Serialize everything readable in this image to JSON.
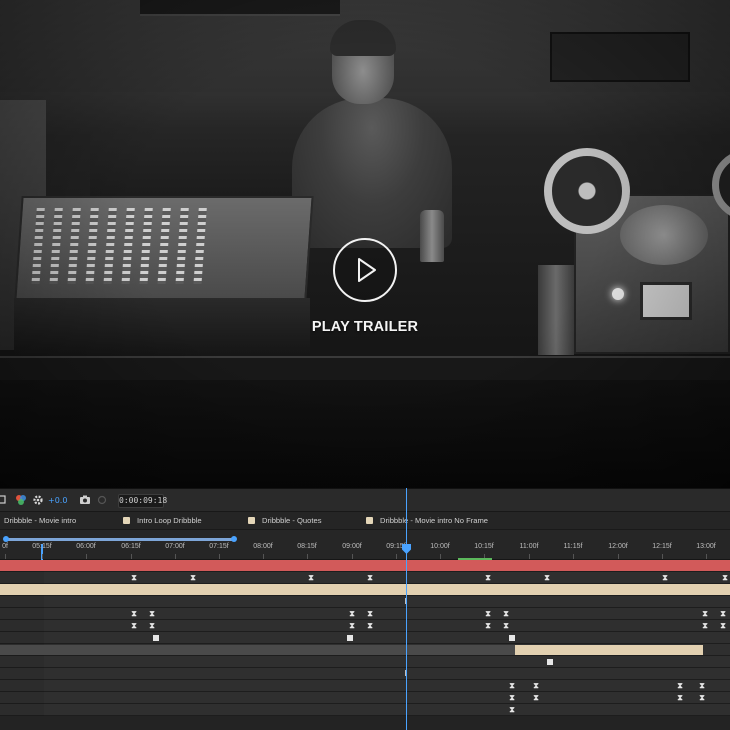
{
  "preview": {
    "play_label": "PLAY TRAILER"
  },
  "toolbar": {
    "zoom": "+0.0",
    "timecode": "0:00:09:18"
  },
  "comp_tabs": [
    {
      "label": "Dribbble - Movie intro",
      "swatch": false
    },
    {
      "label": "Intro Loop Dribbble",
      "swatch": true
    },
    {
      "label": "Dribbble - Quotes",
      "swatch": true
    },
    {
      "label": "Dribbble - Movie intro No Frame",
      "swatch": true
    }
  ],
  "ruler": {
    "ticks": [
      "0f",
      "05:15f",
      "06:00f",
      "06:15f",
      "07:00f",
      "07:15f",
      "08:00f",
      "08:15f",
      "09:00f",
      "09:15f",
      "10:00f",
      "10:15f",
      "11:00f",
      "11:15f",
      "12:00f",
      "12:15f",
      "13:00f"
    ],
    "playhead_time": "09:15f"
  },
  "colors": {
    "accent": "#4aa3ff",
    "red_layer": "#d25a5a",
    "tan_layer": "#e2d0b0",
    "green_marker": "#5cb85c"
  },
  "icons": [
    "layers-icon",
    "color-wheel-icon",
    "gear-icon",
    "camera-icon",
    "mask-icon"
  ]
}
